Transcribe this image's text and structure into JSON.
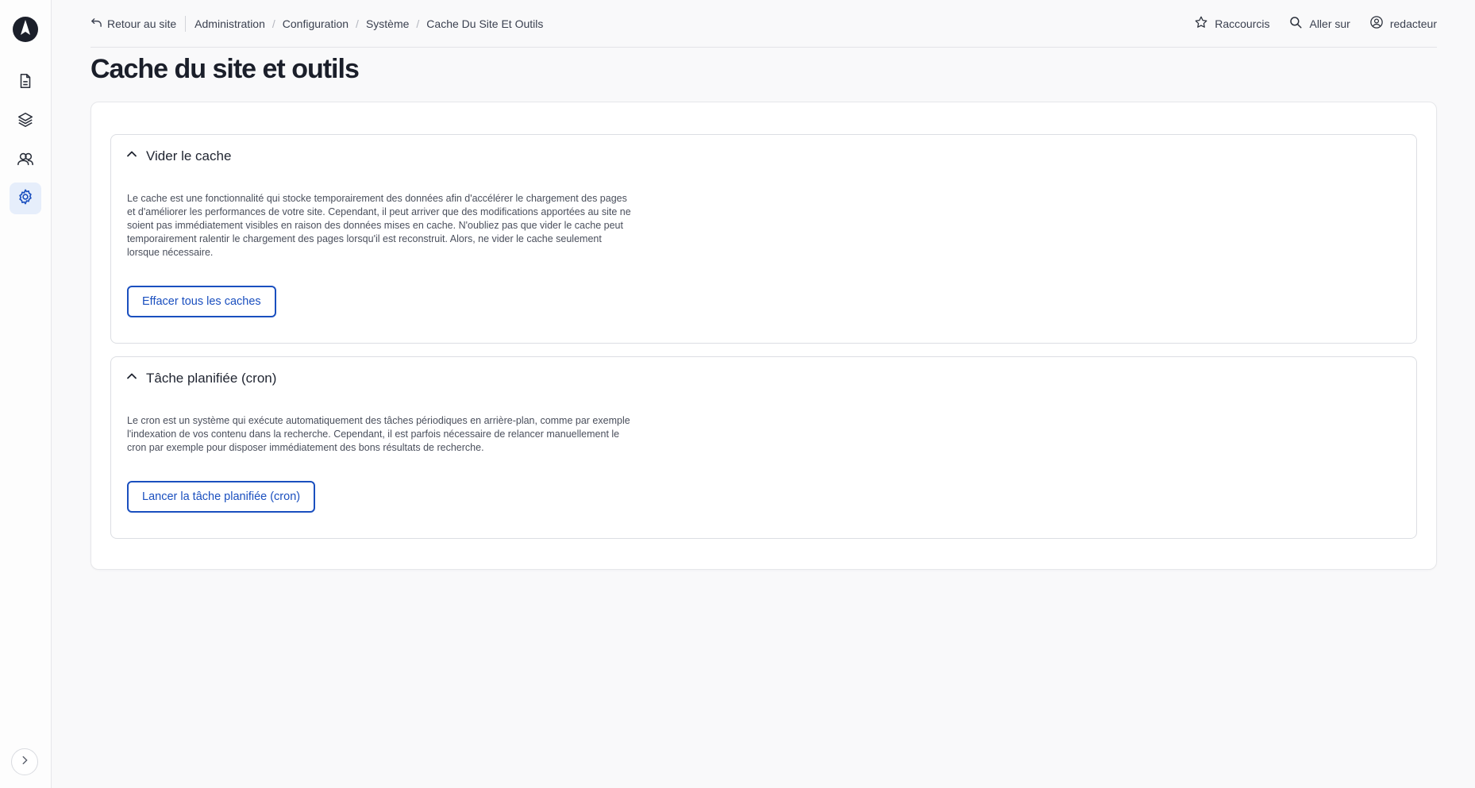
{
  "sidebar": {
    "logo_icon": "rocket-logo-icon",
    "items": [
      {
        "icon": "page-icon",
        "active": false
      },
      {
        "icon": "layers-icon",
        "active": false
      },
      {
        "icon": "users-icon",
        "active": false
      },
      {
        "icon": "gear-icon",
        "active": true
      }
    ],
    "expand_icon": "chevron-right-icon"
  },
  "topbar": {
    "back_label": "Retour au site",
    "breadcrumbs": [
      "Administration",
      "Configuration",
      "Système",
      "Cache Du Site Et Outils"
    ],
    "shortcuts_label": "Raccourcis",
    "goto_label": "Aller sur",
    "user_label": "redacteur"
  },
  "page": {
    "title": "Cache du site et outils"
  },
  "sections": [
    {
      "title": "Vider le cache",
      "description": "Le cache est une fonctionnalité qui stocke temporairement des données afin d'accélérer le chargement des pages et d'améliorer les performances de votre site. Cependant, il peut arriver que des modifications apportées au site ne soient pas immédiatement visibles en raison des données mises en cache. N'oubliez pas que vider le cache peut temporairement ralentir le chargement des pages lorsqu'il est reconstruit. Alors, ne vider le cache seulement lorsque nécessaire.",
      "button_label": "Effacer tous les caches"
    },
    {
      "title": "Tâche planifiée (cron)",
      "description": "Le cron est un système qui exécute automatiquement des tâches périodiques en arrière-plan, comme par exemple l'indexation de vos contenu dans la recherche. Cependant, il est parfois nécessaire de relancer manuellement le cron par exemple pour disposer immédiatement des bons résultats de recherche.",
      "button_label": "Lancer la tâche planifiée (cron)"
    }
  ],
  "colors": {
    "accent": "#1a4fbf",
    "active_bg": "#e6eefb"
  }
}
